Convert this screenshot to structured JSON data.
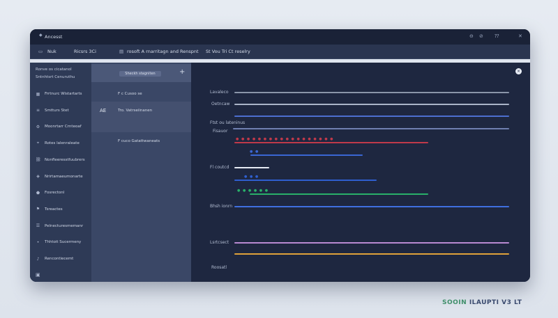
{
  "window": {
    "title": "Ancesst",
    "title_icon": "diamond-icon",
    "controls": [
      "⊖",
      "⊘",
      "⁇",
      "✕"
    ]
  },
  "toolbar": {
    "left_icon": "panel-icon",
    "item1": "Nuk",
    "item2": "Ricsrs 3Ci",
    "doc_icon": "file-icon",
    "item3": "rosoft A rnarritagn and Renspnt",
    "item4": "St Vou Tri Ct reselry"
  },
  "sidebar": {
    "header_line1": "Ronve os cicatanol",
    "header_line2": "Sntnhtsrt Cenuruthu",
    "items": [
      {
        "icon": "grid-icon",
        "label": "Frrtnurc Wistartarts"
      },
      {
        "icon": "list-icon",
        "label": "Smtturs Stet"
      },
      {
        "icon": "gear-icon",
        "label": "Moonrtarr Crnteoaf"
      },
      {
        "icon": "pin-icon",
        "label": "Rotes lalenraleate"
      },
      {
        "icon": "link-icon",
        "label": "Nonfleeresstfuubrers"
      },
      {
        "icon": "cube-icon",
        "label": "Nrirtamaeumonarte"
      },
      {
        "icon": "tag-icon",
        "label": "Fosrectonl"
      },
      {
        "icon": "flag-icon",
        "label": "Tsreactes"
      },
      {
        "icon": "stack-icon",
        "label": "Pelnecturesmemanr"
      },
      {
        "icon": "dot-icon",
        "label": "Thhtoit Sucermeny"
      },
      {
        "icon": "bell-icon",
        "label": "Rencontiecemt"
      }
    ],
    "bottom_icon": "sidebar-toggle-icon"
  },
  "midpanel": {
    "search_placeholder": "Sheckh stagniten",
    "add_label": "+",
    "rows": [
      {
        "text": "F c  Cusoo se",
        "selected": false
      },
      {
        "text": "Tro. Vatrseiinanen",
        "badge": "AE",
        "selected": true
      },
      {
        "text": "F cuco Gatattwaneats",
        "selected": false
      }
    ]
  },
  "editor": {
    "close_label": "×",
    "rows": [
      {
        "label": "Lavaleco",
        "color": "#8a95aa"
      },
      {
        "label": "Oetncaw",
        "color": "#aab4c8"
      },
      {
        "label": "",
        "color": "#4d6fd0"
      },
      {
        "label": "Ftst ou lateninus",
        "color": "#6f7fb0"
      },
      {
        "label": "Fisauor",
        "color": "#aeb8cc"
      },
      {
        "label": "",
        "color": "#c0394a",
        "dots": "● ● ● ● ● ● ● ● ● ● ● ● ● ● ● ● ● ●"
      },
      {
        "label": "",
        "color": "#3a66d4",
        "dots": "● ●"
      },
      {
        "label": "Fl coutcd",
        "color": "#e6ebf4"
      },
      {
        "label": "",
        "color": "#2f5fcf",
        "dots": "● ● ●"
      },
      {
        "label": "",
        "color": "#29b06a",
        "dots": "● ● ● ● ● ●"
      },
      {
        "label": "Bhsh ionrn",
        "color": "#3f6fe0"
      },
      {
        "label": "Lsrtcsect",
        "color": "#b98ad2"
      },
      {
        "label": "",
        "color": "#e0a23a"
      },
      {
        "label": "Roosatl",
        "color": ""
      }
    ]
  },
  "watermark": {
    "brand": "SOOIN",
    "rest": "ILAUPTI V3 LT"
  }
}
